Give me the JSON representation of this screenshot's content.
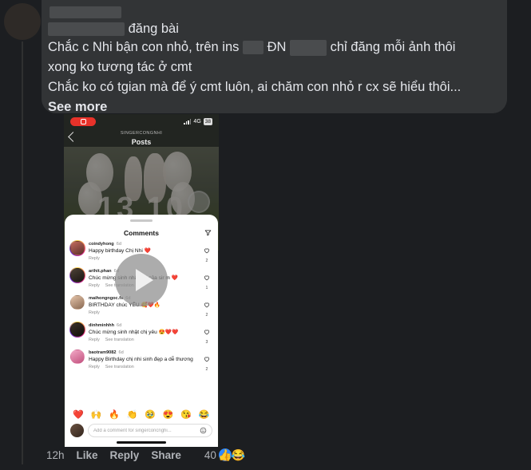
{
  "post": {
    "author_redacted": true,
    "posted_label": "đăng bài",
    "lines": [
      "Chắc c Nhi bận con nhỏ, trên ins",
      "ĐN",
      "chỉ đăng mỗi ảnh thôi",
      "xong ko tương tác ở cmt",
      "Chắc ko có tgian mà để ý cmt luôn, ai chăm con nhỏ r cx sẽ hiểu thôi..."
    ],
    "see_more": "See more"
  },
  "phone": {
    "status": {
      "network": "4G",
      "battery": "38",
      "recording": true
    },
    "header": {
      "handle": "SINGERCONGNHI",
      "title": "Posts"
    },
    "photo": {
      "date_overlay": "13 10"
    },
    "sheet": {
      "title": "Comments",
      "comments": [
        {
          "username": "coindyhong",
          "age": "6d",
          "text": "Happy birthday Chị Nhi ❤️",
          "reply": "Reply",
          "translate": "",
          "likes": "2"
        },
        {
          "username": "arihit.phan",
          "age": "6d",
          "text": "Chúc mừng sinh nhật chị của sir m ❤️",
          "reply": "Reply",
          "translate": "See translation",
          "likes": "1"
        },
        {
          "username": "maihongngoc.fs",
          "age": "6d",
          "text": "BIRTHDAY chúc YÊU 🥰❤️🔥",
          "reply": "Reply",
          "translate": "",
          "likes": "2"
        },
        {
          "username": "dinhminhhh",
          "age": "6d",
          "text": "Chúc mừng sinh nhật chị yêu 😍❤️❤️",
          "reply": "Reply",
          "translate": "See translation",
          "likes": "3"
        },
        {
          "username": "baotram9082",
          "age": "6d",
          "text": "Happy Birthday chị nhi sinh đẹp a dễ thương",
          "reply": "Reply",
          "translate": "See translation",
          "likes": "2"
        }
      ],
      "quick_emojis": [
        "❤️",
        "🙌",
        "🔥",
        "👏",
        "🥹",
        "😍",
        "😘",
        "😂"
      ],
      "compose_placeholder": "Add a comment for singerconcnghi..."
    },
    "play_overlay": true
  },
  "actions": {
    "time": "12h",
    "like": "Like",
    "reply": "Reply",
    "share": "Share",
    "reaction_count": "40",
    "reactions": [
      "👍",
      "😂"
    ]
  },
  "colors": {
    "page_bg": "#1c1e21",
    "bubble_bg": "#323436",
    "text": "#e4e6eb",
    "muted": "#b0b3b8",
    "accent_blue": "#2d88ff",
    "record_red": "#e8322a"
  }
}
